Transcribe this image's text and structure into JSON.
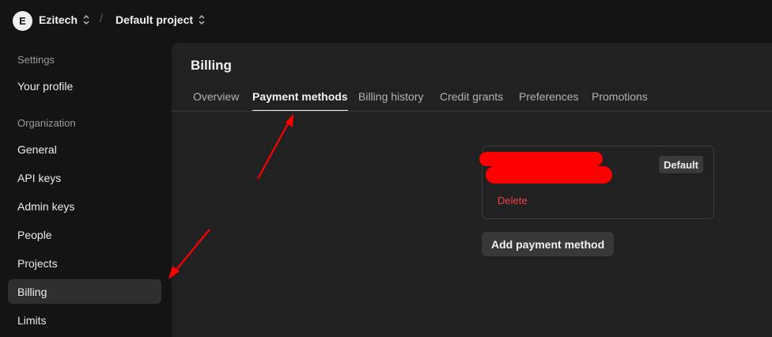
{
  "header": {
    "org_initial": "E",
    "org_name": "Ezitech",
    "separator": "/",
    "project_name": "Default project"
  },
  "sidebar": {
    "settings_heading": "Settings",
    "your_profile": "Your profile",
    "organization_heading": "Organization",
    "items": [
      {
        "label": "General"
      },
      {
        "label": "API keys"
      },
      {
        "label": "Admin keys"
      },
      {
        "label": "People"
      },
      {
        "label": "Projects"
      },
      {
        "label": "Billing",
        "active": true
      },
      {
        "label": "Limits"
      }
    ]
  },
  "main": {
    "title": "Billing",
    "tabs": [
      {
        "label": "Overview"
      },
      {
        "label": "Payment methods",
        "active": true
      },
      {
        "label": "Billing history"
      },
      {
        "label": "Credit grants"
      },
      {
        "label": "Preferences"
      },
      {
        "label": "Promotions"
      }
    ],
    "payment_card": {
      "default_badge": "Default",
      "delete_label": "Delete"
    },
    "add_payment_label": "Add payment method"
  },
  "colors": {
    "accent_red": "#ff0000",
    "delete_red": "#ef4444",
    "panel_bg": "#212121",
    "page_bg": "#141414"
  }
}
